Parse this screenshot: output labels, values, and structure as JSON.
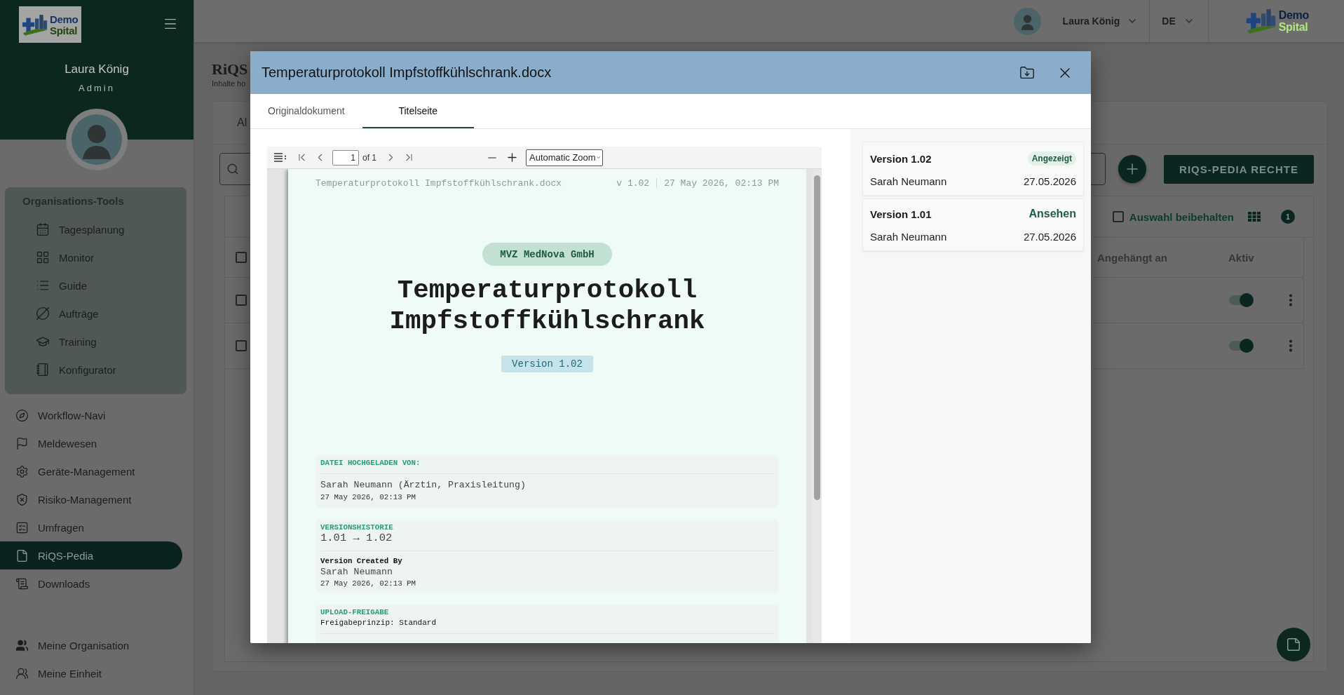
{
  "sidebar": {
    "logo": {
      "line_1": "Demo",
      "line_2": "Spital"
    },
    "user": {
      "name": "Laura König",
      "role": "Admin"
    },
    "tool_group": {
      "title": "Organisations-Tools",
      "items": [
        {
          "label": "Tagesplanung",
          "selected": false
        },
        {
          "label": "Monitor",
          "selected": false
        },
        {
          "label": "Guide",
          "selected": false
        },
        {
          "label": "Aufträge",
          "selected": false
        },
        {
          "label": "Training",
          "selected": false
        },
        {
          "label": "Konfigurator",
          "selected": false
        }
      ]
    },
    "items": [
      {
        "label": "Workflow-Navi",
        "selected": false
      },
      {
        "label": "Meldewesen",
        "selected": false
      },
      {
        "label": "Geräte-Management",
        "selected": false
      },
      {
        "label": "Risiko-Management",
        "selected": false
      },
      {
        "label": "Umfragen",
        "selected": false
      },
      {
        "label": "RiQS-Pedia",
        "selected": true
      },
      {
        "label": "Downloads",
        "selected": false
      }
    ],
    "bottom_items": [
      {
        "label": "Meine Organisation",
        "selected": false
      },
      {
        "label": "Meine Einheit",
        "selected": false
      }
    ]
  },
  "header": {
    "user_name": "Laura König",
    "language": "DE",
    "logo": {
      "line_1": "Demo",
      "line_2": "Spital"
    }
  },
  "page": {
    "title": "RiQS",
    "subtitle": "Inhalte ho",
    "tab": "Al",
    "rights_button": "RIQS-PEDIA RECHTE",
    "keep_selection": {
      "label": "Auswahl beibehalten",
      "checked": false
    },
    "count_badge": "1",
    "table": {
      "columns": [
        "Angehängt an",
        "Aktiv"
      ],
      "header_checked": false,
      "rows": [
        {
          "checked": false,
          "active": true
        },
        {
          "checked": false,
          "active": true
        }
      ]
    }
  },
  "modal": {
    "title": "Temperaturprotokoll Impfstoffkühlschrank.docx",
    "tabs": [
      {
        "label": "Originaldokument",
        "selected": false
      },
      {
        "label": "Titelseite",
        "selected": true
      }
    ],
    "viewer": {
      "page_input": "1",
      "page_count": "of 1",
      "zoom": "Automatic Zoom",
      "document": {
        "file_name": "Temperaturprotokoll Impfstoffkühlschrank.docx",
        "version": "v 1.02",
        "date": "27 May 2026, 02:13 PM",
        "organization": "MVZ MedNova GmbH",
        "title": "Temperaturprotokoll Impfstoffkühlschrank",
        "version_badge": "Version 1.02",
        "sections": [
          {
            "kind": "uploader",
            "label": "DATEI HOCHGELADEN VON:",
            "name": "Sarah Neumann (Ärztin, Praxisleitung)",
            "date": "27 May 2026, 02:13 PM"
          },
          {
            "kind": "history",
            "label": "VERSIONSHISTORIE",
            "change": "1.01 → 1.02",
            "creator_heading": "Version Created By",
            "name": "Sarah Neumann",
            "date": "27 May 2026, 02:13 PM"
          },
          {
            "kind": "release",
            "label": "UPLOAD-FREIGABE",
            "value": "Freigabeprinzip: Standard"
          }
        ]
      }
    },
    "versions": [
      {
        "version": "Version 1.02",
        "action": "Angezeigt",
        "current": true,
        "author": "Sarah Neumann",
        "date": "27.05.2026"
      },
      {
        "version": "Version 1.01",
        "action": "Ansehen",
        "current": false,
        "author": "Sarah Neumann",
        "date": "27.05.2026"
      }
    ]
  }
}
